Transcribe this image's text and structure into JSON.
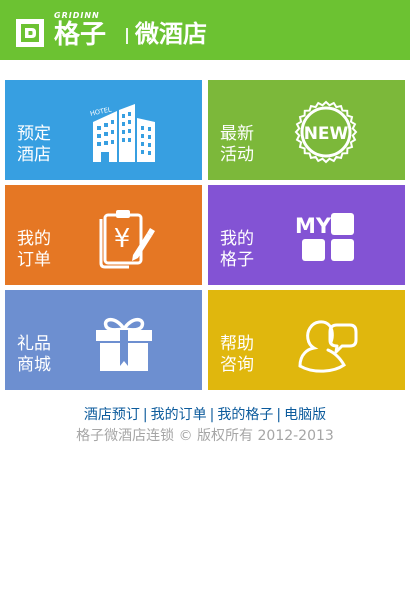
{
  "header": {
    "logo_en": "GRIDINN",
    "logo_cn": "格子",
    "subtitle": "微酒店",
    "background": "#6cc232"
  },
  "tiles": [
    {
      "line1": "预定",
      "line2": "酒店",
      "icon": "hotel-building-icon",
      "hotel_sign": "HOTEL",
      "color": "#379fe1"
    },
    {
      "line1": "最新",
      "line2": "活动",
      "icon": "new-badge-icon",
      "badge_text": "NEW",
      "color": "#7cb83a"
    },
    {
      "line1": "我的",
      "line2": "订单",
      "icon": "order-clipboard-icon",
      "currency_symbol": "¥",
      "color": "#e57724"
    },
    {
      "line1": "我的",
      "line2": "格子",
      "icon": "my-grid-icon",
      "badge_text": "MY",
      "color": "#8353d4"
    },
    {
      "line1": "礼品",
      "line2": "商城",
      "icon": "gift-box-icon",
      "color": "#6d8fd0"
    },
    {
      "line1": "帮助",
      "line2": "咨询",
      "icon": "help-chat-icon",
      "color": "#e0b70d"
    }
  ],
  "footer": {
    "links": [
      "酒店预订",
      "我的订单",
      "我的格子",
      "电脑版"
    ],
    "separator": "|",
    "copyright": "格子微酒店连锁 © 版权所有 2012-2013"
  }
}
